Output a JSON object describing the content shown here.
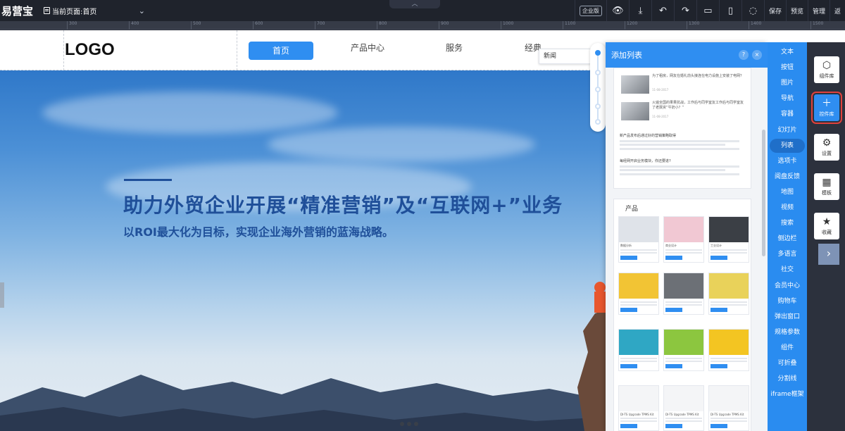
{
  "toolbar": {
    "brand": "易营宝",
    "current_page": "当前页面:首页",
    "enterprise_badge": "企业版",
    "save": "保存",
    "preview": "预览",
    "manage": "管理",
    "back": "返",
    "icons": [
      "eye-icon",
      "align-icon",
      "undo-icon",
      "redo-icon",
      "desktop-icon",
      "mobile-icon",
      "help-icon"
    ]
  },
  "ruler_labels": [
    "300",
    "400",
    "500",
    "600",
    "700",
    "800",
    "900",
    "1000",
    "1100",
    "1200",
    "1300",
    "1400",
    "1500"
  ],
  "site": {
    "logo": "LOGO",
    "nav": [
      "首页",
      "产品中心",
      "服务",
      "经典"
    ],
    "hero_title": "助力外贸企业开展“精准营销”及“互联网+”业务",
    "hero_subtitle": "以ROI最大化为目标，实现企业海外营销的蓝海战略。"
  },
  "news_tip": "新闻",
  "panel": {
    "title": "添加列表",
    "help": "?",
    "close": "×",
    "news": [
      {
        "title": "为了租房，网友在婚礼前头接连在电力设施上安装了电网？",
        "date": "11-08-2017"
      },
      {
        "title": "火遍全国的果果抗战，工作后与同学室友工作后与同学室友了老撰资“牛奶小？”",
        "date": "11-08-2017"
      }
    ],
    "text_items": [
      "新产品发布后通过好的营销策略取得",
      "每经网开启业务模块，你还要进?"
    ],
    "products_title": "产品",
    "products": [
      {
        "label": "数据分析",
        "color": "#dfe3e9"
      },
      {
        "label": "商业设计",
        "color": "#f1c8d3"
      },
      {
        "label": "工业设计",
        "color": "#3b3f45"
      },
      {
        "label": "",
        "color": "#f2c434"
      },
      {
        "label": "",
        "color": "#6c7076"
      },
      {
        "label": "",
        "color": "#e9d25a"
      },
      {
        "label": "",
        "color": "#2fa7c4"
      },
      {
        "label": "",
        "color": "#8cc63f"
      },
      {
        "label": "",
        "color": "#f3c522"
      },
      {
        "label": "DI-TS Upgrade TPMS Kit",
        "color": "#f4f5f7"
      },
      {
        "label": "DI-TS Upgrade TPMS Kit",
        "color": "#f4f5f7"
      },
      {
        "label": "DI-TS Upgrade TPMS Kit",
        "color": "#f4f5f7"
      }
    ]
  },
  "categories": [
    "文本",
    "按钮",
    "图片",
    "导航",
    "容器",
    "幻灯片",
    "列表",
    "选项卡",
    "阅盘反馈",
    "地图",
    "视频",
    "搜索",
    "侧边栏",
    "多语言",
    "社交",
    "会员中心",
    "购物车",
    "弹出窗口",
    "规格参数",
    "组件",
    "可折叠",
    "分割线",
    "iframe框架"
  ],
  "active_category": "列表",
  "rail": [
    {
      "label": "组件库",
      "icon": "cube-icon",
      "glyph": "⬡"
    },
    {
      "label": "控件库",
      "icon": "plus-icon",
      "glyph": "＋"
    },
    {
      "label": "设置",
      "icon": "gear-icon",
      "glyph": "⚙"
    },
    {
      "label": "模板",
      "icon": "grid-icon",
      "glyph": "▦"
    },
    {
      "label": "收藏",
      "icon": "star-icon",
      "glyph": "★"
    }
  ],
  "rail_arrow": "›"
}
